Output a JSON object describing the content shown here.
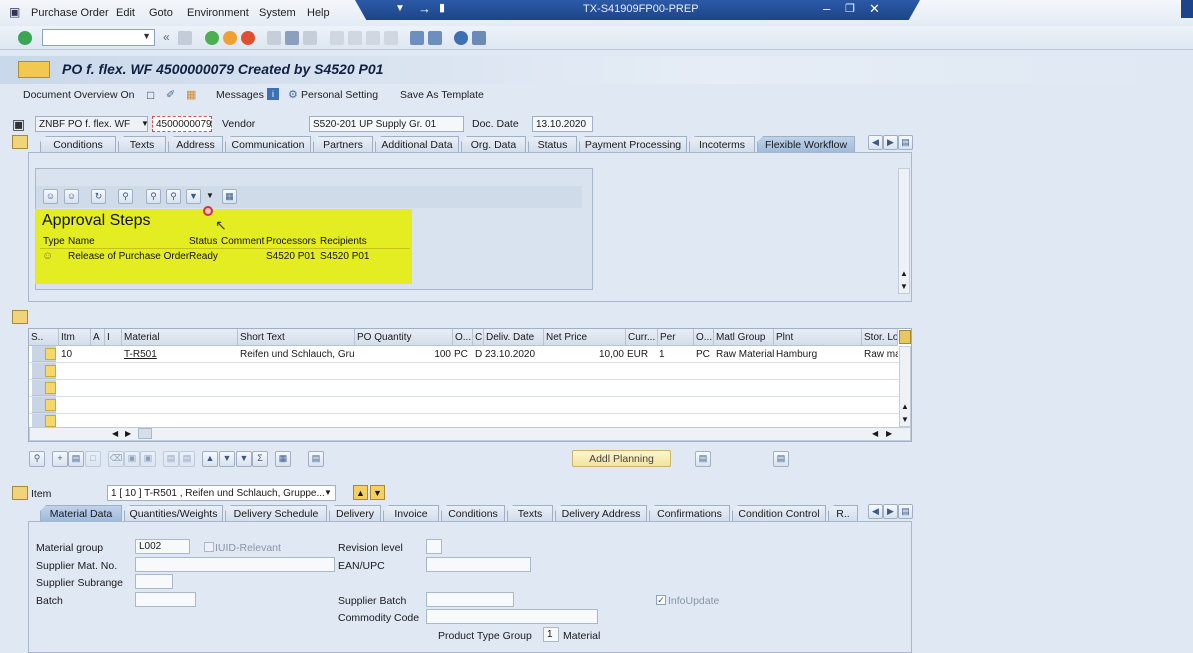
{
  "menu": [
    "Purchase Order",
    "Edit",
    "Goto",
    "Environment",
    "System",
    "Help"
  ],
  "window_title": "TX-S41909FP00-PREP",
  "title": "PO f. flex. WF 4500000079 Created by S4520 P01",
  "app_toolbar": {
    "doc_overview": "Document Overview On",
    "messages": "Messages",
    "personal_setting": "Personal Setting",
    "save_template": "Save As Template"
  },
  "header": {
    "doc_type": "ZNBF PO f. flex. WF",
    "po_number": "4500000079",
    "vendor_label": "Vendor",
    "vendor_value": "S520-201 UP Supply Gr. 01",
    "doc_date_label": "Doc. Date",
    "doc_date_value": "13.10.2020"
  },
  "header_tabs": [
    "Conditions",
    "Texts",
    "Address",
    "Communication",
    "Partners",
    "Additional Data",
    "Org. Data",
    "Status",
    "Payment Processing",
    "Incoterms",
    "Flexible Workflow"
  ],
  "approval": {
    "heading": "Approval Steps",
    "columns": [
      "Type",
      "Name",
      "Status",
      "Comment",
      "Processors",
      "Recipients"
    ],
    "row": {
      "name": "Release of Purchase Order",
      "status": "Ready",
      "comment": "",
      "processors": "S4520 P01",
      "recipients": "S4520 P01"
    }
  },
  "items_table": {
    "columns": [
      "S..",
      "Itm",
      "A",
      "I",
      "Material",
      "Short Text",
      "PO Quantity",
      "O...",
      "C",
      "Deliv. Date",
      "Net Price",
      "Curr...",
      "Per",
      "O...",
      "Matl Group",
      "Plnt",
      "Stor. Lo"
    ],
    "row": {
      "itm": "10",
      "material": "T-R501",
      "short_text": "Reifen und Schlauch, Gru...",
      "quantity": "100",
      "unit": "PC",
      "cat": "D",
      "deliv_date": "23.10.2020",
      "net_price": "10,00",
      "currency": "EUR",
      "per": "1",
      "order_unit": "PC",
      "matl_group": "Raw Materials",
      "plant": "Hamburg",
      "stor_loc": "Raw ma"
    }
  },
  "addl_planning": "Addl Planning",
  "item_label": "Item",
  "item_select": "1 [ 10 ] T-R501 , Reifen und Schlauch, Gruppe...",
  "item_tabs": [
    "Material Data",
    "Quantities/Weights",
    "Delivery Schedule",
    "Delivery",
    "Invoice",
    "Conditions",
    "Texts",
    "Delivery Address",
    "Confirmations",
    "Condition Control",
    "R.."
  ],
  "material_data": {
    "material_group_label": "Material group",
    "material_group_value": "L002",
    "iuid_label": "IUID-Relevant",
    "revision_label": "Revision level",
    "supplier_mat_label": "Supplier Mat. No.",
    "ean_label": "EAN/UPC",
    "supplier_subrange_label": "Supplier Subrange",
    "batch_label": "Batch",
    "supplier_batch_label": "Supplier Batch",
    "infoupdate_label": "InfoUpdate",
    "commodity_label": "Commodity Code",
    "product_type_label": "Product Type Group",
    "product_type_value": "1",
    "product_type_text": "Material"
  }
}
